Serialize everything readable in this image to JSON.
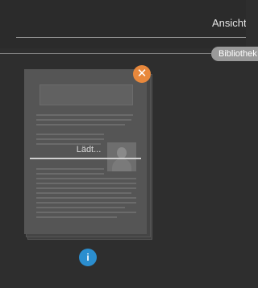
{
  "header": {
    "view_label": "Ansicht"
  },
  "tabs": {
    "library_label": "Bibliothek"
  },
  "document_card": {
    "loading_text": "Lädt..."
  },
  "icons": {
    "close": "close-icon",
    "info": "info-icon"
  },
  "colors": {
    "background": "#2e2e2e",
    "close_accent": "#e8883c",
    "info_accent": "#2b8ecf",
    "tab_background": "#9a9a9a"
  }
}
